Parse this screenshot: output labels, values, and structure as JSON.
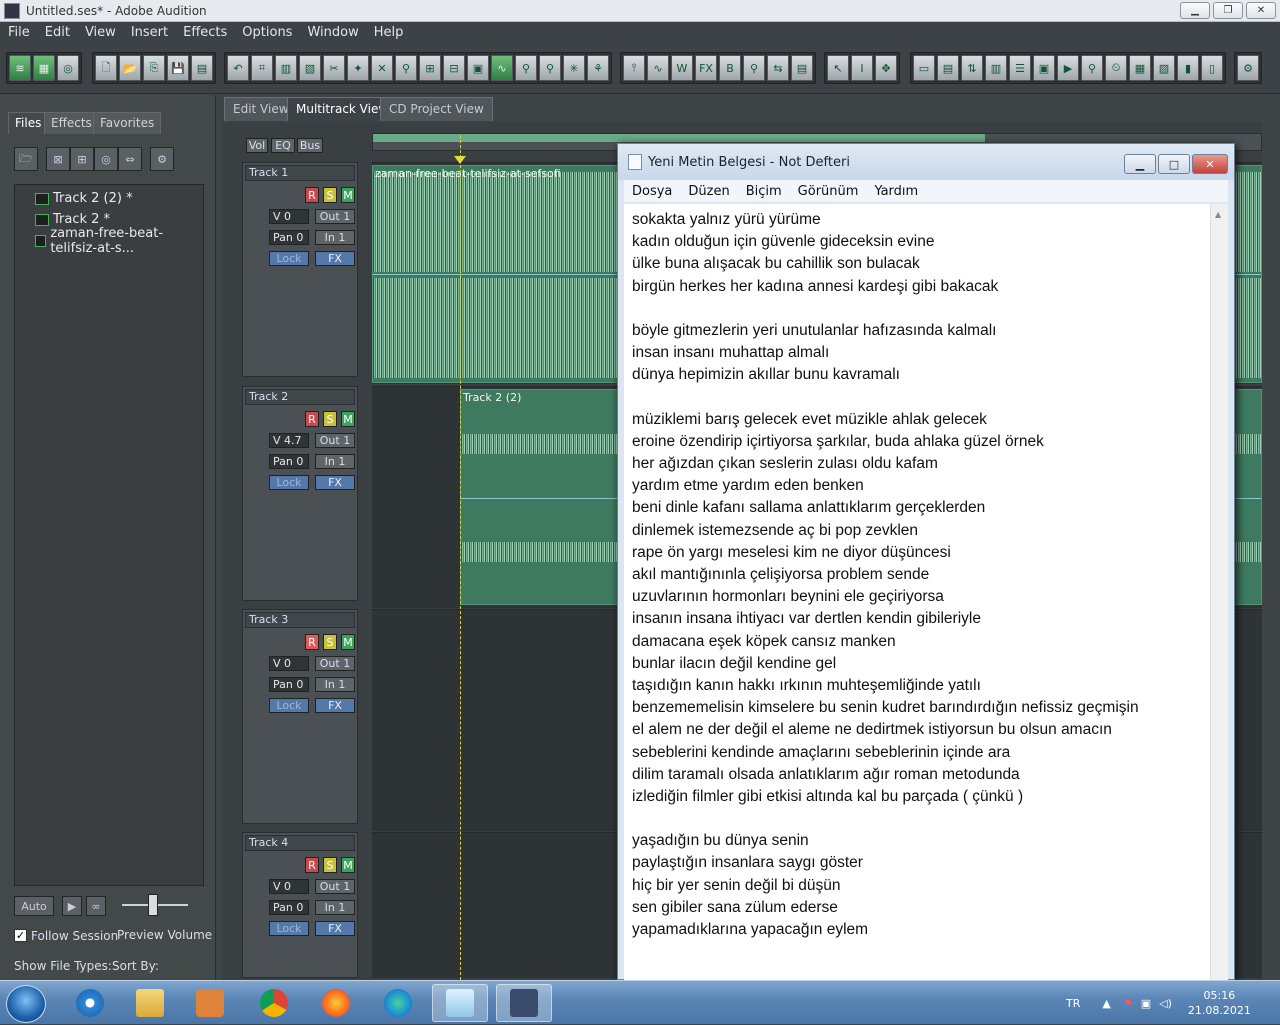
{
  "window": {
    "title": "Untitled.ses* - Adobe Audition"
  },
  "menubar": {
    "items": [
      "File",
      "Edit",
      "View",
      "Insert",
      "Effects",
      "Options",
      "Window",
      "Help"
    ]
  },
  "left_panel": {
    "tabs": [
      "Files",
      "Effects",
      "Favorites"
    ],
    "files": [
      "Track 2 (2) *",
      "Track 2 *",
      "zaman-free-beat-telifsiz-at-s..."
    ],
    "auto_label": "Auto",
    "follow_session": "Follow Session",
    "preview_volume": "Preview Volume",
    "show_file_types": "Show File Types:",
    "sort_by": "Sort By:"
  },
  "view_tabs": [
    "Edit View",
    "Multitrack View",
    "CD Project View"
  ],
  "mixer_tabs": [
    "Vol",
    "EQ",
    "Bus"
  ],
  "tracks": [
    {
      "name": "Track 1",
      "vol": "V 0",
      "pan": "Pan 0",
      "out": "Out 1",
      "in": "In 1",
      "lock": "Lock",
      "fx": "FX",
      "clip": "zaman-free-beat-telifsiz-at-sefsofi"
    },
    {
      "name": "Track 2",
      "vol": "V 4.7",
      "pan": "Pan 0",
      "out": "Out 1",
      "in": "In 1",
      "lock": "Lock",
      "fx": "FX",
      "clip": "Track 2 (2)"
    },
    {
      "name": "Track 3",
      "vol": "V 0",
      "pan": "Pan 0",
      "out": "Out 1",
      "in": "In 1",
      "lock": "Lock",
      "fx": "FX",
      "clip": ""
    },
    {
      "name": "Track 4",
      "vol": "V 0",
      "pan": "Pan 0",
      "out": "Out 1",
      "in": "In 1",
      "lock": "Lock",
      "fx": "FX",
      "clip": ""
    }
  ],
  "rsm": {
    "r": "R",
    "s": "S",
    "m": "M"
  },
  "notepad": {
    "title": "Yeni Metin Belgesi - Not Defteri",
    "menu": [
      "Dosya",
      "Düzen",
      "Biçim",
      "Görünüm",
      "Yardım"
    ],
    "lines": [
      "sokakta yalnız yürü yürüme",
      "kadın olduğun için güvenle gideceksin evine",
      "ülke buna alışacak bu cahillik son bulacak",
      "birgün herkes her kadına annesi kardeşi gibi bakacak",
      "",
      "böyle gitmezlerin yeri unutulanlar hafızasında kalmalı",
      "insan insanı muhattap almalı",
      "dünya hepimizin akıllar bunu kavramalı",
      "",
      "müziklemi barış gelecek evet müzikle ahlak gelecek",
      "eroine özendirip içirtiyorsa şarkılar, buda ahlaka güzel örnek",
      "her ağızdan çıkan seslerin zulası oldu kafam",
      "yardım etme yardım eden benken",
      "beni dinle kafanı sallama anlattıklarım gerçeklerden",
      "dinlemek istemezsende aç bi pop zevklen",
      "rape ön yargı meselesi kim ne diyor düşüncesi",
      "akıl mantığınınla çelişiyorsa problem sende",
      "uzuvlarının hormonları beynini ele geçiriyorsa",
      "insanın insana ihtiyacı var dertlen kendin gibileriyle",
      "damacana eşek köpek cansız manken",
      "bunlar ilacın değil kendine gel",
      "taşıdığın kanın hakkı ırkının muhteşemliğinde yatılı",
      "benzememelisin kimselere bu senin kudret barındırdığın nefissiz geçmişin",
      "el alem ne der değil el aleme ne dedirtmek istiyorsun bu olsun amacın",
      "sebeblerini kendinde amaçlarını sebeblerinin içinde ara",
      "dilim taramalı olsada anlatıklarım ağır roman metodunda",
      "izlediğin filmler gibi etkisi altında kal bu parçada ( çünkü )",
      "",
      "yaşadığın bu dünya senin",
      "paylaştığın insanlara saygı göster",
      "hiç bir yer senin değil bi düşün",
      "sen gibiler sana zülum ederse",
      "yapamadıklarına yapacağın eylem"
    ]
  },
  "taskbar": {
    "lang": "TR",
    "time": "05:16",
    "date": "21.08.2021"
  },
  "colors": {
    "track_clip": "#3d7a5f",
    "record": "#c94a4a",
    "solo": "#c8c23a",
    "mute": "#3aa55a"
  }
}
